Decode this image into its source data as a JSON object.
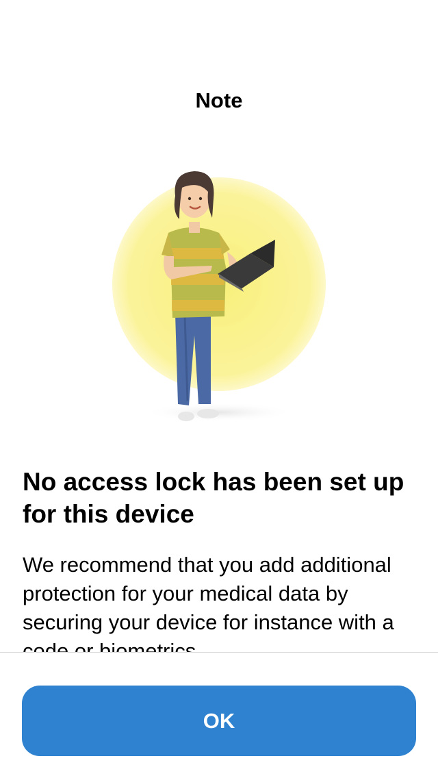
{
  "header": {
    "title": "Note"
  },
  "illustration": {
    "icon": "person-with-laptop-illustration"
  },
  "content": {
    "headline": "No access lock has been set up for this device",
    "body": "We recommend that you add additional protection for your medical data by securing your device for instance with a code or biometrics."
  },
  "actions": {
    "ok_label": "OK"
  },
  "colors": {
    "accent": "#2f82d0",
    "background": "#ffffff",
    "text": "#000000",
    "divider": "#d9d9d9",
    "circle": "#fbf28f"
  }
}
